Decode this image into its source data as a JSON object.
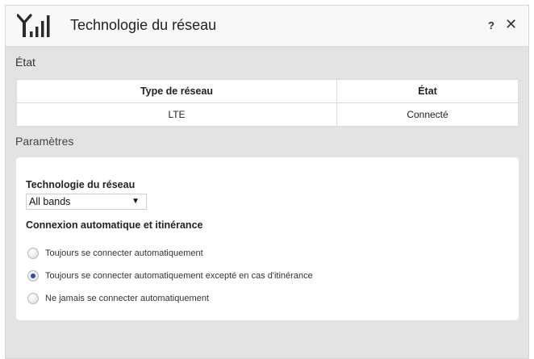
{
  "window": {
    "title": "Technologie du réseau",
    "help_label": "?",
    "close_label": "✕"
  },
  "status": {
    "section_label": "État",
    "columns": [
      "Type de réseau",
      "État"
    ],
    "rows": [
      [
        "LTE",
        "Connecté"
      ]
    ]
  },
  "settings": {
    "section_label": "Paramètres",
    "network_tech_label": "Technologie du réseau",
    "network_tech_value": "All bands",
    "auto_connect_label": "Connexion automatique et itinérance",
    "options": [
      {
        "label": "Toujours se connecter automatiquement",
        "checked": false
      },
      {
        "label": "Toujours se connecter automatiquement excepté en cas d'itinérance",
        "checked": true
      },
      {
        "label": "Ne jamais se connecter automatiquement",
        "checked": false
      }
    ]
  },
  "icons": {
    "window_icon": "signal-strength-icon",
    "dropdown_icon": "triangle-down-icon"
  },
  "colors": {
    "dialog_bg": "#e3e3e5",
    "panel_bg": "#ffffff",
    "radio_selected": "#2b4fa8"
  }
}
